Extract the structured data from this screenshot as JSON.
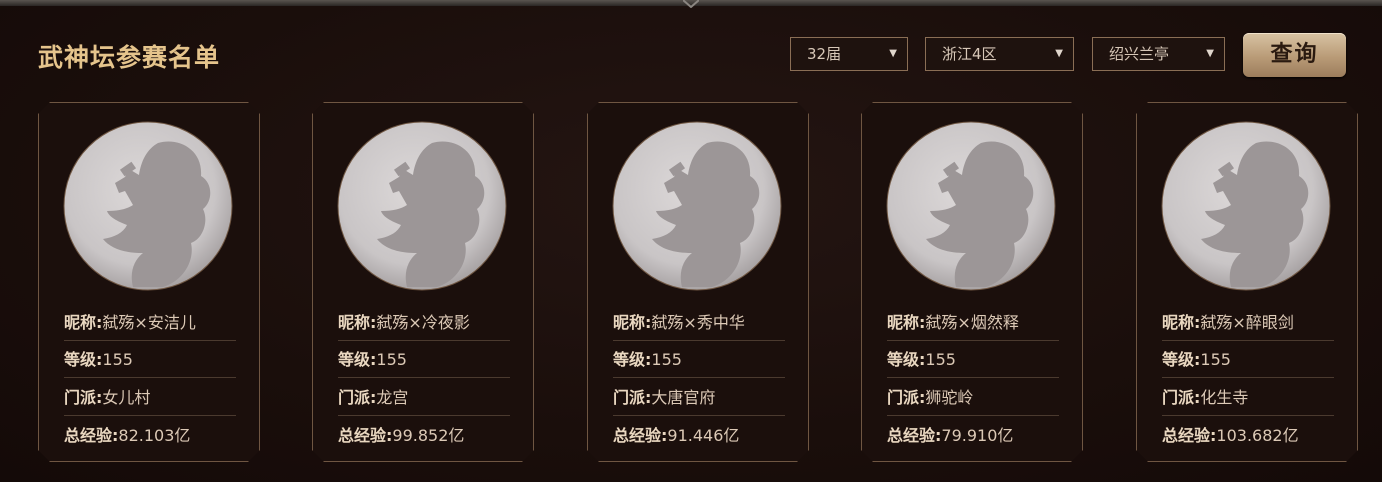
{
  "header": {
    "title": "武神坛参赛名单",
    "filters": [
      {
        "selected": "32届"
      },
      {
        "selected": "浙江4区"
      },
      {
        "selected": "绍兴兰亭"
      }
    ],
    "query_label": "查询"
  },
  "labels": {
    "nickname": "昵称:",
    "level": "等级:",
    "school": "门派:",
    "exp": "总经验:"
  },
  "players": [
    {
      "nickname": "弑殇×安洁儿",
      "level": "155",
      "school": "女儿村",
      "exp": "82.103亿"
    },
    {
      "nickname": "弑殇×冷夜影",
      "level": "155",
      "school": "龙宫",
      "exp": "99.852亿"
    },
    {
      "nickname": "弑殇×秀中华",
      "level": "155",
      "school": "大唐官府",
      "exp": "91.446亿"
    },
    {
      "nickname": "弑殇×烟然释",
      "level": "155",
      "school": "狮驼岭",
      "exp": "79.910亿"
    },
    {
      "nickname": "弑殇×醉眼剑",
      "level": "155",
      "school": "化生寺",
      "exp": "103.682亿"
    }
  ],
  "colors": {
    "title": "#e5c48c",
    "card_border": "#6f5642",
    "button": "#c9ad88"
  }
}
